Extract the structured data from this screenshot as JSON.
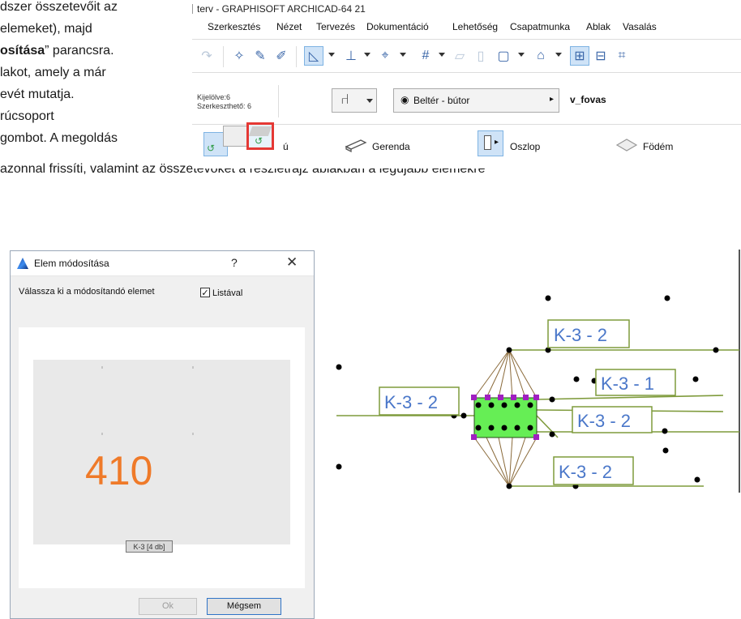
{
  "document": {
    "lines": [
      "dszer összetevőit az",
      "elemeket), majd",
      "osítása",
      "” parancsra.",
      "lakot, amely a már",
      "evét mutatja.",
      "rúcsoport",
      "gombot. A megoldás",
      "azonnal frissíti, valamint az összetevőket a részletrajz ablakban a legújabb elemekre"
    ]
  },
  "archicad": {
    "title": "terv - GRAPHISOFT ARCHICAD-64 21",
    "menu": [
      "Szerkesztés",
      "Nézet",
      "Tervezés",
      "Dokumentáció",
      "Lehetőség",
      "Csapatmunka",
      "Ablak",
      "Vasalás"
    ],
    "info": {
      "selected": "Kijelölve:6",
      "editable": "Szerkeszthető: 6",
      "layer": "Beltér - bútor",
      "layer_icon": "eye-icon",
      "name": "v_fovas"
    },
    "elements": {
      "partial": "ú",
      "beam": "Gerenda",
      "column": "Oszlop",
      "slab": "Födém"
    },
    "highlight_color": "#e53935"
  },
  "dialog": {
    "title": "Elem módosítása",
    "help": "?",
    "close": "✕",
    "prompt": "Válassza ki a módosítandó elemet",
    "checkbox_label": "Listával",
    "checkbox_checked": true,
    "preview_number": "410",
    "preview_tag": "K-3 [4 db]",
    "ok": "Ok",
    "cancel": "Mégsem"
  },
  "plan": {
    "labels": [
      "K-3 - 2",
      "K-3 - 2",
      "K-3 - 1",
      "K-3 - 2",
      "K-3 - 2"
    ],
    "label_color": "#4a77c9",
    "line_color": "#7f9b3c",
    "fill_color": "#66ee55",
    "handle_color": "#a020c0"
  }
}
